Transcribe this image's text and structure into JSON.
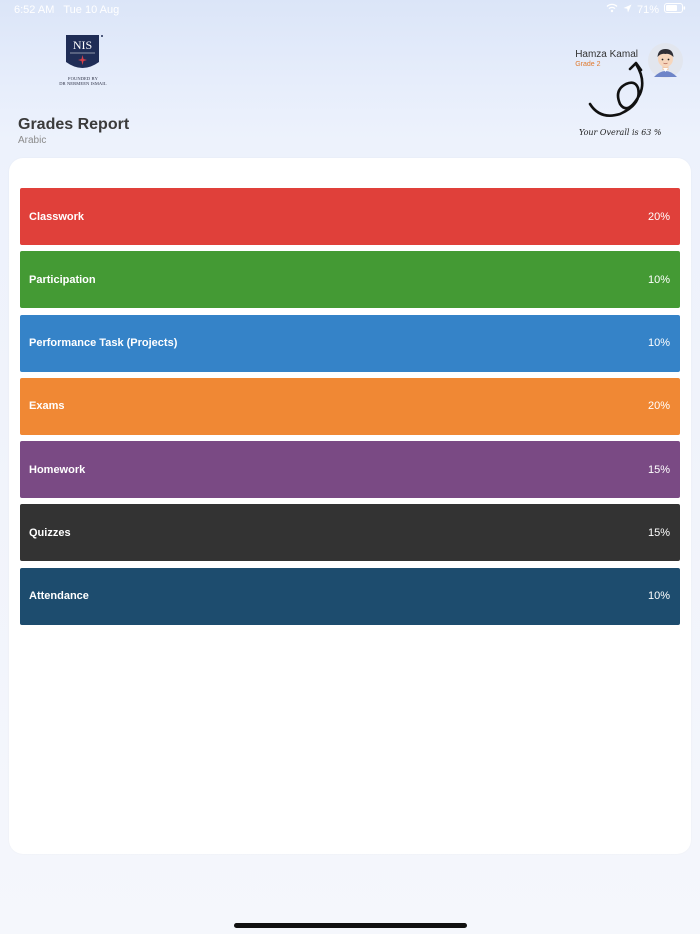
{
  "status_bar": {
    "time": "6:52 AM",
    "date": "Tue 10 Aug",
    "battery": "71%"
  },
  "logo": {
    "text": "NIS",
    "caption_line1": "FOUNDED BY",
    "caption_line2": "DR NERMEEN ISMAIL"
  },
  "user": {
    "name": "Hamza Kamal",
    "grade": "Grade 2",
    "overall": "Your Overall is  63 %"
  },
  "header": {
    "title": "Grades Report",
    "subject": "Arabic"
  },
  "grades": [
    {
      "label": "Classwork",
      "percent": "20%",
      "color": "#e0403a"
    },
    {
      "label": "Participation",
      "percent": "10%",
      "color": "#449a34"
    },
    {
      "label": "Performance Task (Projects)",
      "percent": "10%",
      "color": "#3583c8"
    },
    {
      "label": "Exams",
      "percent": "20%",
      "color": "#f08834"
    },
    {
      "label": "Homework",
      "percent": "15%",
      "color": "#7a4a84"
    },
    {
      "label": "Quizzes",
      "percent": "15%",
      "color": "#333333"
    },
    {
      "label": "Attendance",
      "percent": "10%",
      "color": "#1d4c6e"
    }
  ]
}
